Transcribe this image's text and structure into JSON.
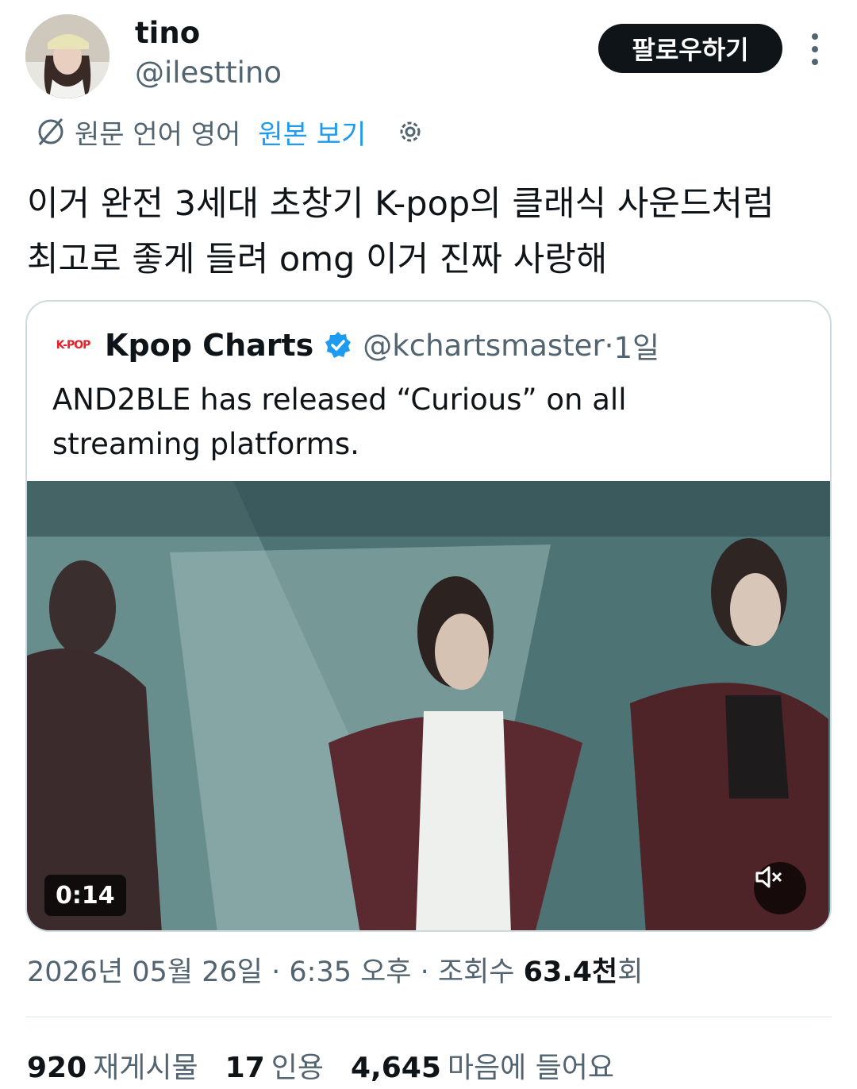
{
  "author": {
    "display_name": "tino",
    "handle": "@ilesttino",
    "follow_label": "팔로우하기"
  },
  "translation": {
    "note": "원문 언어 영어",
    "view_original": "원본 보기"
  },
  "tweet": {
    "line1": "이거 완전 3세대 초창기 K-pop의 클래식 사운드처럼",
    "line2": "최고로 좋게 들려 omg 이거 진짜 사랑해"
  },
  "quote": {
    "logo_text": "K-POP",
    "name": "Kpop Charts",
    "handle": "@kchartsmaster",
    "separator": " · ",
    "time": "1일",
    "text_line1": "AND2BLE has released “Curious” on all",
    "text_line2": "streaming platforms.",
    "video": {
      "duration": "0:14"
    }
  },
  "meta": {
    "date": "2026년 05월 26일",
    "sep1": " · ",
    "time": "6:35 오후",
    "sep2": " · ",
    "views_label": "조회수 ",
    "views_count": "63.4천",
    "views_suffix": "회"
  },
  "stats": {
    "reposts_count": "920",
    "reposts_label": "재게시물",
    "quotes_count": "17",
    "quotes_label": "인용",
    "likes_count": "4,645",
    "likes_label": "마음에 들어요"
  },
  "colors": {
    "accent": "#1d9bf0",
    "text": "#0f1419",
    "secondary": "#536471",
    "follow_bg": "#0f1419"
  },
  "icons": {
    "translate": "globe-slash-icon",
    "settings": "gear-icon",
    "verified": "verified-badge-icon",
    "more": "more-vertical-icon",
    "mute": "speaker-muted-icon"
  }
}
